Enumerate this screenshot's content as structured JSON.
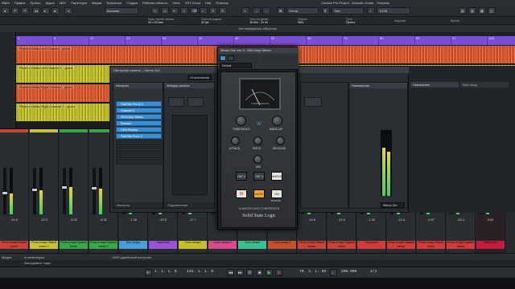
{
  "app": {
    "title": "Cubase Pro Project - Acoustic Guitar - Template",
    "menu": [
      "Файл",
      "Правка",
      "Проект",
      "Аудио",
      "MIDI",
      "Партитура",
      "Медиа",
      "Транспорт",
      "Студия",
      "Рабочая область",
      "Окно",
      "VST Cloud",
      "Hub",
      "Помощь"
    ]
  },
  "toolbar": {
    "automation_mode": "Касание",
    "grid_mode": "Сетка",
    "quantize_label": "Такт",
    "quantize_value": "1/128"
  },
  "info_line": {
    "items": [
      "Макс. время записи",
      "16 ч 20 мин",
      "Частота кадров",
      "30 fps",
      "Частота дискр.",
      "48 kHz - 24 bit",
      "Запись",
      "WAV",
      "Путь",
      "Проект",
      "Загрузка",
      "Время"
    ],
    "message": "Нет выбранных объектов"
  },
  "ruler": {
    "bars": [
      "1",
      "9",
      "17",
      "25",
      "33",
      "41",
      "49",
      "57",
      "65",
      "73",
      "81",
      "89",
      "97",
      "105"
    ]
  },
  "tracks": [
    {
      "name": "Rhythm Guitar Left Channel - glued",
      "color": "red"
    },
    {
      "name": "Rhythm Guitar Left Channel 2 - glued",
      "color": "yellow"
    },
    {
      "name": "Rhythm Guitar Right Channel - glued",
      "color": "red"
    },
    {
      "name": "Rhythm Guitar Right Channel 2 - glued",
      "color": "yellow"
    }
  ],
  "channel_window": {
    "title": "Настройки канала – Stereo Out",
    "inserts_label": "Инсерты",
    "strip_label": "Фейдер канала",
    "routing_label": "19 источников",
    "sends_label": "Назначение",
    "inserts_footer": "Инсерты",
    "strip_footer": "Подключения",
    "inserts": [
      "FabFilter Pro-Q 3",
      "Channel S",
      "SSLComp Stereo",
      "Deesser",
      "CDN Preamp",
      "FabFilter Pro-L 2"
    ]
  },
  "plugin": {
    "title": "Stereo Out: Ins. 4 - SSLComp Stereo",
    "preset": "Default",
    "brand": "Solid State Logic",
    "subtitle": "G-MASTER BUSS COMPRESSOR",
    "meter_label": "COMPRESSION",
    "knobs": [
      "THRESHOLD",
      "MAKE-UP",
      "ATTACK",
      "RATIO",
      "RELEASE",
      "MIX"
    ],
    "buttons": [
      "IN",
      "AUTO",
      "MAKEUP",
      "RAT 2",
      "RAT 4"
    ],
    "on_button": "ON",
    "bypass_label": "BYPASS"
  },
  "right_panel": {
    "tabs": [
      "Назначение",
      "Мон. вход"
    ],
    "output": "Stereo Out"
  },
  "mixer": {
    "channels": [
      {
        "name": "Ритм гитара Левый канал",
        "value": "-10.0",
        "color": "#c7433a",
        "level": 0.45
      },
      {
        "name": "Ритм гитара Левый канал 2",
        "value": "-10.3",
        "color": "#c8c23a",
        "level": 0.52
      },
      {
        "name": "Ритм гитара Правый канал",
        "value": "-6.32",
        "color": "#3aa848",
        "level": 0.58
      },
      {
        "name": "Ритм гитара Правый канал 2",
        "value": "-6.32",
        "color": "#3aa848",
        "level": 0.55
      },
      {
        "name": "Бас гитара",
        "value": "-1.36",
        "color": "#4a9fd9",
        "level": 0.62
      },
      {
        "name": "Барабаны",
        "value": "-10.5",
        "color": "#9a53d6",
        "level": 0.4
      },
      {
        "name": "Соло гитара",
        "value": "-27.7",
        "color": "#c9bf2e",
        "level": 0.2
      },
      {
        "name": "Соло гитара 2",
        "value": "-17.3",
        "color": "#d74a8f",
        "level": 0.34
      },
      {
        "name": "Соло гитара",
        "value": "-10.6",
        "color": "#3fbf8f",
        "level": 0.43
      },
      {
        "name": "Соло гитара 2",
        "value": "-5.01",
        "color": "#c6502e",
        "level": 0.6
      },
      {
        "name": "Ритм гитара Левый канал",
        "value": "-12.8",
        "color": "#c7433a",
        "level": 0.4
      },
      {
        "name": "Ритм гитара Правый канал",
        "value": "-12.4",
        "color": "#c7433a",
        "level": 0.41
      },
      {
        "name": "Перкуссия",
        "value": "-1.30",
        "color": "#d13b3b",
        "level": 0.66
      },
      {
        "name": "Ритм гитара Правый канал",
        "value": "-12.4",
        "color": "#d13b3b",
        "level": 0.39
      },
      {
        "name": "Ритм гитара Левый канал",
        "value": "-0.67",
        "color": "#d13b3b",
        "level": 0.7
      },
      {
        "name": "Ритм гитара Правый канал",
        "value": "-23.4",
        "color": "#d13b3b",
        "level": 0.25
      },
      {
        "name": "Stereo Out",
        "value": "0.00",
        "color": "#c21d3f",
        "level": 0.75
      }
    ]
  },
  "status_bar": {
    "left": "Медиа",
    "sample": "ю семплером",
    "monitor": "MIDI удалённый контроль",
    "aux": "Аккордовые пэды"
  },
  "transport": {
    "left_locator": "1. 1. 1. 0",
    "right_locator": "145. 1. 1. 0",
    "position": "70. 3. 1. 98",
    "tempo": "200.000",
    "signature": "4/4"
  },
  "colors": {
    "accent": "#7a4fd6",
    "insert_active": "#3d8fd0",
    "stereo_out": "#c21d3f"
  }
}
